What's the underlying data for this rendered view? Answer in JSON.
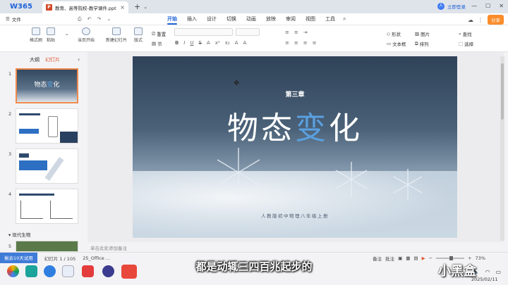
{
  "app": {
    "logo": "W365"
  },
  "tab": {
    "icon": "P",
    "title": "教育、高等院校-教学课件.ppt",
    "close": "×",
    "add": "+",
    "more": "⌄"
  },
  "login": {
    "avatar": "人",
    "label": "立即登录"
  },
  "window_controls": [
    "—",
    "☐",
    "✕"
  ],
  "menubar": {
    "file": "文件",
    "quick": [
      "⎙",
      "↶",
      "↷",
      "⌄"
    ],
    "items": [
      "开始",
      "插入",
      "设计",
      "切换",
      "动画",
      "放映",
      "审阅",
      "视图",
      "工具"
    ],
    "active": "开始",
    "share": "分享"
  },
  "ribbon": {
    "format_brush": "格式刷",
    "paste": "粘贴",
    "cut_copy": "⌄",
    "from_current": "当页开始",
    "new_slide": "新建幻灯片",
    "layout": "版式",
    "reset": "重置",
    "section": "节",
    "shape": "形状",
    "picture": "图片",
    "textbox": "文本框",
    "arrange": "排列",
    "find": "查找",
    "select": "选择",
    "font_buttons": [
      "B",
      "I",
      "U",
      "S",
      "A",
      "x²",
      "x₂",
      "A",
      "A"
    ],
    "para_buttons": [
      "≡",
      "≡",
      "≡",
      "≡",
      "≡",
      "≡",
      "⇥"
    ]
  },
  "leftpane": {
    "tabs": [
      "大纲",
      "幻灯片"
    ],
    "active_tab": "幻灯片",
    "collapse": "‹",
    "slide_numbers": [
      "1",
      "2",
      "3",
      "4",
      "5"
    ],
    "section_label": "▾ 现代生物"
  },
  "note_placeholder": "单击此处添加备注",
  "slide": {
    "chapter": "第三章",
    "title_a": "物态",
    "title_b": "变",
    "title_c": "化",
    "subtitle": "人教版初中物理八年级上册"
  },
  "status": {
    "trial": "剩余10天试用",
    "slide_info": "幻灯片 1 / 105",
    "office": "25_Office ...",
    "notes": "备注",
    "comments": "批注",
    "zoom": "73%",
    "zoom_fraction": 0.55
  },
  "caption": "都是动辄三四百兆起步的",
  "watermark": "小黑盒",
  "date": "2025/02/11",
  "colors": {
    "accent": "#1e63d8",
    "trial": "#3f7bd8",
    "share": "#fb8c2b",
    "selected_thumb": "#f08a4b"
  }
}
